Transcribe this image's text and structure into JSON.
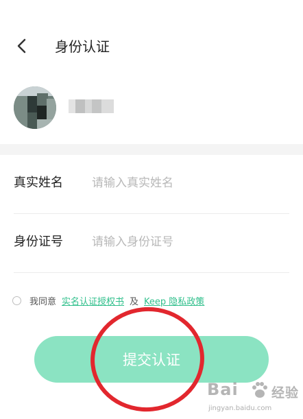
{
  "header": {
    "title": "身份认证",
    "back_icon": "chevron-left-icon"
  },
  "form": {
    "name_label": "真实姓名",
    "name_placeholder": "请输入真实姓名",
    "name_value": "",
    "id_label": "身份证号",
    "id_placeholder": "请输入身份证号",
    "id_value": ""
  },
  "agreement": {
    "prefix": "我同意",
    "link1": "实名认证授权书",
    "conj": "及",
    "link2": "Keep 隐私政策"
  },
  "submit": {
    "label": "提交认证"
  },
  "watermark": {
    "main": "Bai",
    "brand": "经验",
    "sub": "jingyan.baidu.com"
  },
  "colors": {
    "accent": "#2fbf8b",
    "button": "#8be3c2",
    "annotation": "#e2272e"
  }
}
